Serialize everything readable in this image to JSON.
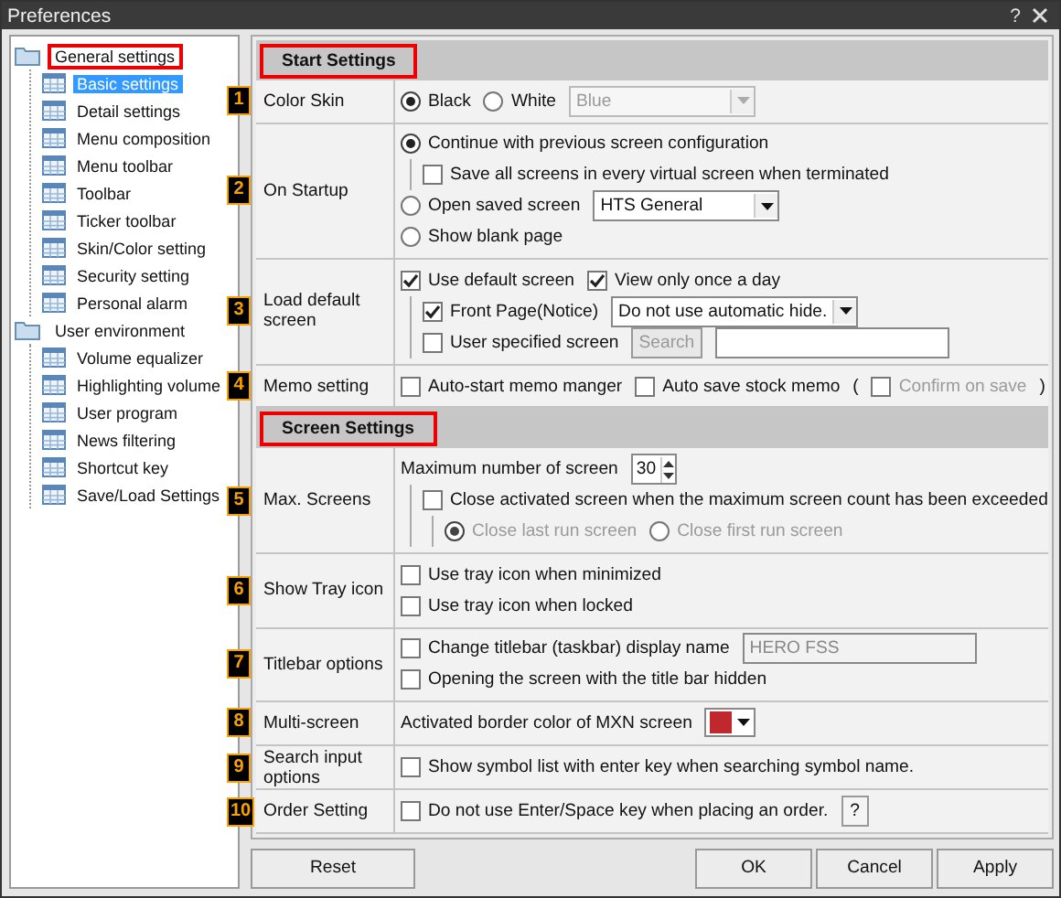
{
  "window": {
    "title": "Preferences",
    "help_label": "?"
  },
  "tree": [
    {
      "label": "General settings",
      "highlighted": true,
      "children": [
        {
          "label": "Basic settings",
          "selected": true
        },
        {
          "label": "Detail settings",
          "selected": false
        },
        {
          "label": "Menu composition",
          "selected": false
        },
        {
          "label": "Menu toolbar",
          "selected": false
        },
        {
          "label": "Toolbar",
          "selected": false
        },
        {
          "label": "Ticker toolbar",
          "selected": false
        },
        {
          "label": "Skin/Color setting",
          "selected": false
        },
        {
          "label": "Security setting",
          "selected": false
        },
        {
          "label": "Personal alarm",
          "selected": false
        }
      ]
    },
    {
      "label": "User environment",
      "highlighted": false,
      "children": [
        {
          "label": "Volume equalizer",
          "selected": false
        },
        {
          "label": "Highlighting volume",
          "selected": false
        },
        {
          "label": "User program",
          "selected": false
        },
        {
          "label": "News filtering",
          "selected": false
        },
        {
          "label": "Shortcut key",
          "selected": false
        },
        {
          "label": "Save/Load Settings",
          "selected": false
        }
      ]
    }
  ],
  "sections": [
    {
      "title": "Start Settings",
      "highlighted": true,
      "rows": [
        {
          "badge": "1",
          "label": "Color Skin",
          "items": [
            {
              "parts": [
                {
                  "kind": "radio",
                  "label": "Black",
                  "selected": true,
                  "disabled": false
                },
                {
                  "kind": "radio",
                  "label": "White",
                  "selected": false,
                  "disabled": false
                },
                {
                  "kind": "select",
                  "value": "Blue",
                  "disabled": true
                }
              ]
            }
          ]
        },
        {
          "badge": "2",
          "label": "On Startup",
          "items": [
            {
              "parts": [
                {
                  "kind": "radio",
                  "label": "Continue with previous screen configuration",
                  "selected": true,
                  "disabled": false
                }
              ],
              "children": [
                {
                  "parts": [
                    {
                      "kind": "checkbox",
                      "label": "Save all screens in every virtual screen when terminated",
                      "checked": false,
                      "disabled": false
                    }
                  ]
                }
              ]
            },
            {
              "parts": [
                {
                  "kind": "radio",
                  "label": "Open saved screen",
                  "selected": false,
                  "disabled": false
                },
                {
                  "kind": "select",
                  "value": "HTS General",
                  "disabled": false
                }
              ]
            },
            {
              "parts": [
                {
                  "kind": "radio",
                  "label": "Show blank page",
                  "selected": false,
                  "disabled": false
                }
              ]
            }
          ]
        },
        {
          "badge": "3",
          "label": "Load default screen",
          "items": [
            {
              "parts": [
                {
                  "kind": "checkbox",
                  "label": "Use default screen",
                  "checked": true,
                  "disabled": false
                },
                {
                  "kind": "checkbox",
                  "label": "View only once a day",
                  "checked": true,
                  "disabled": false
                }
              ],
              "children": [
                {
                  "parts": [
                    {
                      "kind": "checkbox",
                      "label": "Front Page(Notice)",
                      "checked": true,
                      "disabled": false
                    },
                    {
                      "kind": "select",
                      "value": "Do not use automatic hide.",
                      "disabled": false
                    }
                  ]
                },
                {
                  "parts": [
                    {
                      "kind": "checkbox",
                      "label": "User specified screen",
                      "checked": false,
                      "disabled": false
                    },
                    {
                      "kind": "button",
                      "label": "Search",
                      "disabled": true
                    },
                    {
                      "kind": "input",
                      "disabled": false
                    }
                  ]
                }
              ]
            }
          ]
        },
        {
          "badge": "4",
          "label": "Memo setting",
          "items": [
            {
              "parts": [
                {
                  "kind": "checkbox",
                  "label": "Auto-start memo manger",
                  "checked": false,
                  "disabled": false
                },
                {
                  "kind": "checkbox",
                  "label": "Auto save stock memo",
                  "checked": false,
                  "disabled": false
                },
                {
                  "kind": "text",
                  "label": "("
                },
                {
                  "kind": "checkbox",
                  "label": "Confirm on save",
                  "checked": false,
                  "disabled": true
                },
                {
                  "kind": "text",
                  "label": ")"
                }
              ]
            }
          ]
        }
      ]
    },
    {
      "title": "Screen Settings",
      "highlighted": true,
      "rows": [
        {
          "badge": "5",
          "label": "Max. Screens",
          "items": [
            {
              "parts": [
                {
                  "kind": "text",
                  "label": "Maximum number of screen"
                },
                {
                  "kind": "spinner",
                  "value": "30"
                }
              ],
              "children": [
                {
                  "parts": [
                    {
                      "kind": "checkbox",
                      "label": "Close activated screen when the maximum screen count has been exceeded",
                      "checked": false,
                      "disabled": false
                    }
                  ],
                  "children": [
                    {
                      "parts": [
                        {
                          "kind": "radio",
                          "label": "Close last run screen",
                          "selected": true,
                          "disabled": true
                        },
                        {
                          "kind": "radio",
                          "label": "Close first run screen",
                          "selected": false,
                          "disabled": true
                        }
                      ]
                    }
                  ]
                }
              ]
            }
          ]
        },
        {
          "badge": "6",
          "label": "Show Tray icon",
          "items": [
            {
              "parts": [
                {
                  "kind": "checkbox",
                  "label": "Use tray icon when minimized",
                  "checked": false,
                  "disabled": false
                }
              ]
            },
            {
              "parts": [
                {
                  "kind": "checkbox",
                  "label": "Use tray icon when locked",
                  "checked": false,
                  "disabled": false
                }
              ]
            }
          ]
        },
        {
          "badge": "7",
          "label": "Titlebar options",
          "items": [
            {
              "parts": [
                {
                  "kind": "checkbox",
                  "label": "Change titlebar (taskbar) display name",
                  "checked": false,
                  "disabled": false
                },
                {
                  "kind": "input",
                  "value": "HERO FSS",
                  "disabled": true
                }
              ]
            },
            {
              "parts": [
                {
                  "kind": "checkbox",
                  "label": "Opening the screen with the title bar hidden",
                  "checked": false,
                  "disabled": false
                }
              ]
            }
          ]
        },
        {
          "badge": "8",
          "label": "Multi-screen",
          "items": [
            {
              "parts": [
                {
                  "kind": "text",
                  "label": "Activated border color of MXN screen"
                },
                {
                  "kind": "color-select",
                  "color": "#c0282d"
                }
              ]
            }
          ]
        },
        {
          "badge": "9",
          "label": "Search input options",
          "items": [
            {
              "parts": [
                {
                  "kind": "checkbox",
                  "label": "Show symbol list with enter key when searching symbol name.",
                  "checked": false,
                  "disabled": false
                }
              ]
            }
          ]
        },
        {
          "badge": "10",
          "label": "Order Setting",
          "items": [
            {
              "parts": [
                {
                  "kind": "checkbox",
                  "label": "Do not use Enter/Space key when placing an order.",
                  "checked": false,
                  "disabled": false
                },
                {
                  "kind": "help-button",
                  "label": "?"
                }
              ]
            }
          ]
        }
      ]
    }
  ],
  "buttons_left": [
    "Reset"
  ],
  "buttons_right": [
    "OK",
    "Cancel",
    "Apply"
  ]
}
